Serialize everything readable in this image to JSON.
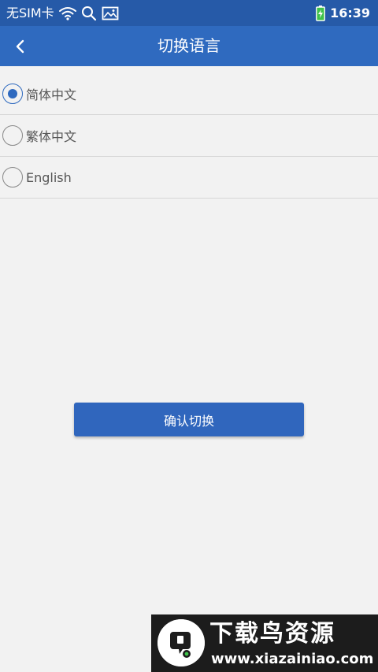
{
  "status_bar": {
    "carrier": "无SIM卡",
    "time": "16:39",
    "icons": [
      "wifi-icon",
      "search-icon",
      "image-icon",
      "battery-charging-icon"
    ]
  },
  "app_bar": {
    "back_icon": "chevron-left-icon",
    "title": "切换语言"
  },
  "languages": [
    {
      "label": "简体中文",
      "selected": true
    },
    {
      "label": "繁体中文",
      "selected": false
    },
    {
      "label": "English",
      "selected": false
    }
  ],
  "confirm_button": {
    "label": "确认切换"
  },
  "watermark": {
    "title": "下载鸟资源",
    "url": "www.xiazainiao.com"
  },
  "colors": {
    "status_bar": "#265aa8",
    "app_bar": "#2f6abf",
    "accent": "#2f6abf",
    "background": "#f2f2f2",
    "watermark_bg": "#1c1c1c"
  }
}
